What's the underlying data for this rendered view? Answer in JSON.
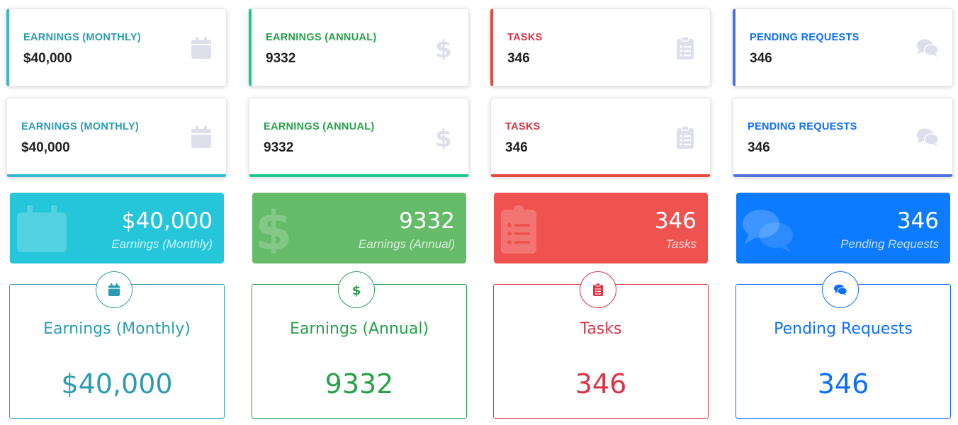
{
  "colors": {
    "info": "#36b9cc",
    "success": "#1cc88a",
    "danger": "#e74a3b",
    "primary": "#4e73df",
    "icon_muted": "#dddfeb"
  },
  "row1": [
    {
      "label": "EARNINGS (MONTHLY)",
      "value": "$40,000",
      "icon": "calendar-icon"
    },
    {
      "label": "EARNINGS (ANNUAL)",
      "value": "9332",
      "icon": "dollar-icon"
    },
    {
      "label": "TASKS",
      "value": "346",
      "icon": "clipboard-list-icon"
    },
    {
      "label": "PENDING REQUESTS",
      "value": "346",
      "icon": "comments-icon"
    }
  ],
  "row2": [
    {
      "label": "EARNINGS (MONTHLY)",
      "value": "$40,000",
      "icon": "calendar-icon"
    },
    {
      "label": "EARNINGS (ANNUAL)",
      "value": "9332",
      "icon": "dollar-icon"
    },
    {
      "label": "TASKS",
      "value": "346",
      "icon": "clipboard-list-icon"
    },
    {
      "label": "PENDING REQUESTS",
      "value": "346",
      "icon": "comments-icon"
    }
  ],
  "row3": [
    {
      "label": "Earnings (Monthly)",
      "value": "$40,000",
      "icon": "calendar-icon",
      "bg": "#26c6da"
    },
    {
      "label": "Earnings (Annual)",
      "value": "9332",
      "icon": "dollar-icon",
      "bg": "#66bb6a"
    },
    {
      "label": "Tasks",
      "value": "346",
      "icon": "clipboard-list-icon",
      "bg": "#ef5350"
    },
    {
      "label": "Pending Requests",
      "value": "346",
      "icon": "comments-icon",
      "bg": "#0d7bff"
    }
  ],
  "row4": [
    {
      "label": "Earnings (Monthly)",
      "value": "$40,000",
      "icon": "calendar-icon"
    },
    {
      "label": "Earnings (Annual)",
      "value": "9332",
      "icon": "dollar-icon"
    },
    {
      "label": "Tasks",
      "value": "346",
      "icon": "clipboard-list-icon"
    },
    {
      "label": "Pending Requests",
      "value": "346",
      "icon": "comments-icon"
    }
  ]
}
